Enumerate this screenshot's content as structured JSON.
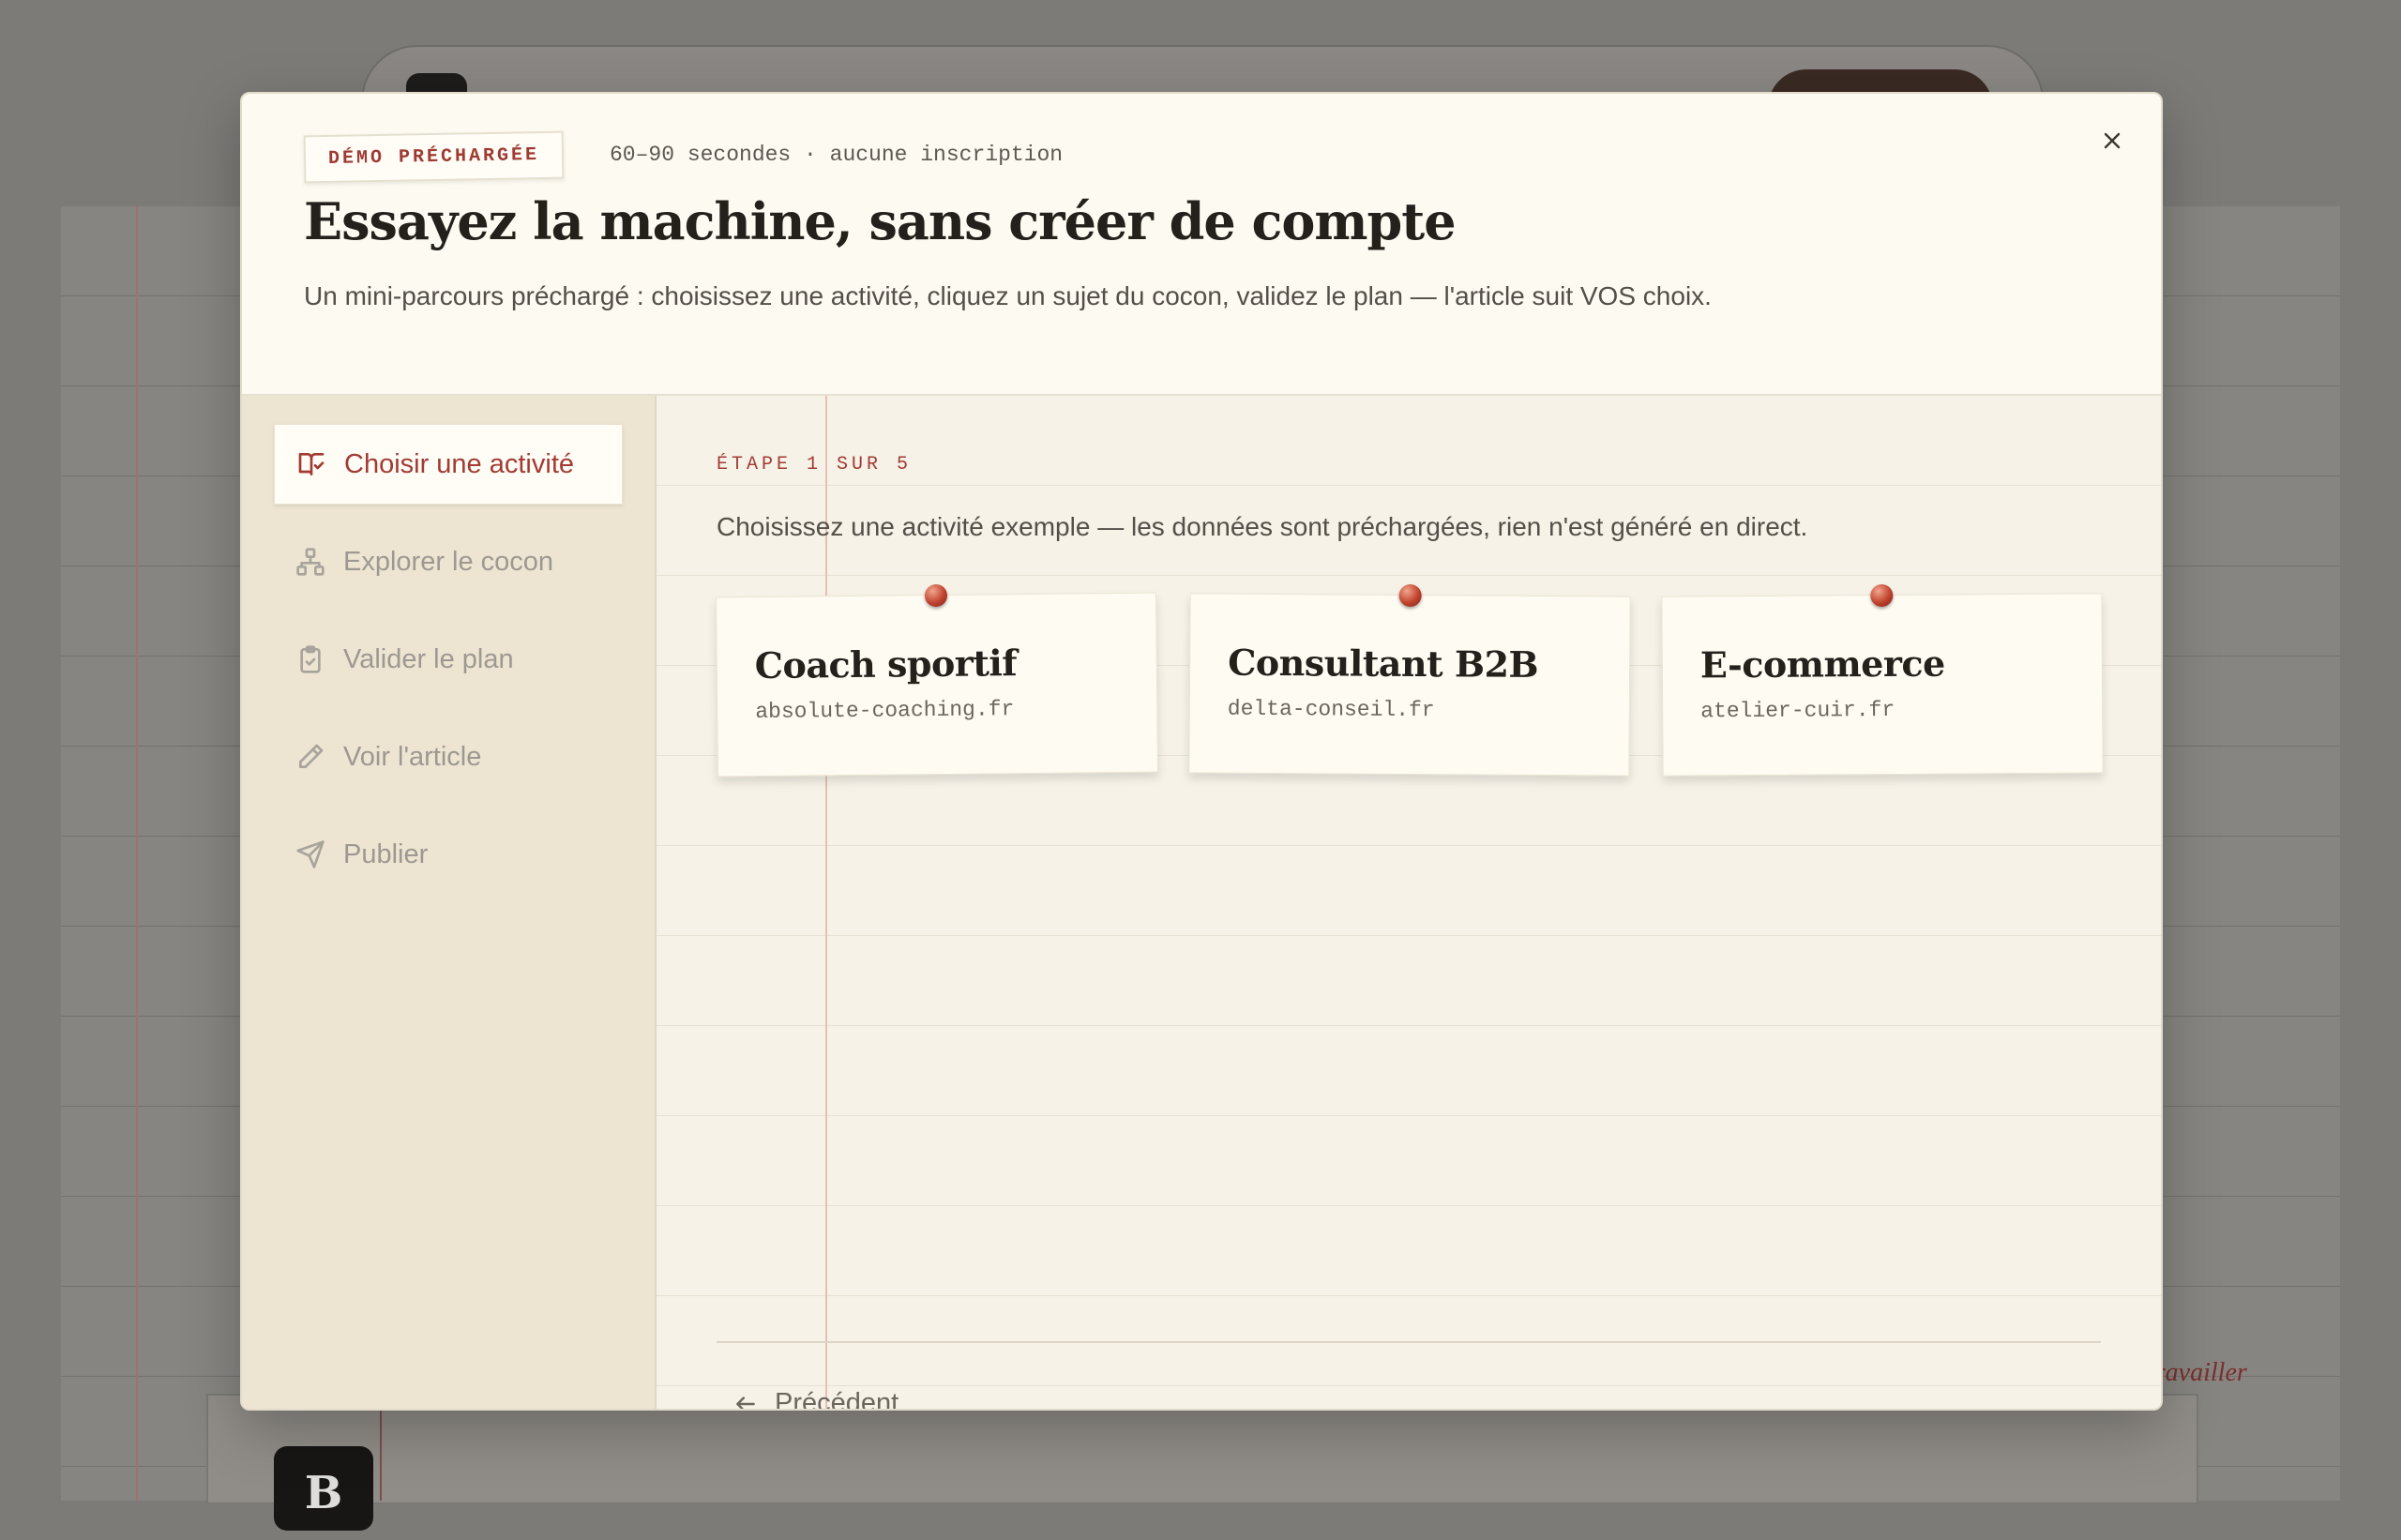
{
  "modal": {
    "badge": "DÉMO PRÉCHARGÉE",
    "meta": "60–90 secondes · aucune inscription",
    "title": "Essayez la machine, sans créer de compte",
    "subtitle": "Un mini-parcours préchargé : choisissez une activité, cliquez un sujet du cocon, validez le plan — l'article suit VOS choix."
  },
  "steps": [
    {
      "label": "Choisir une activité",
      "icon": "book-check-icon",
      "active": true
    },
    {
      "label": "Explorer le cocon",
      "icon": "network-icon",
      "active": false
    },
    {
      "label": "Valider le plan",
      "icon": "clipboard-check-icon",
      "active": false
    },
    {
      "label": "Voir l'article",
      "icon": "pencil-icon",
      "active": false
    },
    {
      "label": "Publier",
      "icon": "send-icon",
      "active": false
    }
  ],
  "main": {
    "step_label": "ÉTAPE 1 SUR 5",
    "intro": "Choisissez une activité exemple — les données sont préchargées, rien n'est généré en direct.",
    "cards": [
      {
        "title": "Coach sportif",
        "domain": "absolute-coaching.fr"
      },
      {
        "title": "Consultant B2B",
        "domain": "delta-conseil.fr"
      },
      {
        "title": "E-commerce",
        "domain": "atelier-cuir.fr"
      }
    ],
    "prev_label": "Précédent"
  },
  "background": {
    "note": "travailler",
    "card_logo": "B"
  },
  "colors": {
    "accent": "#a23b33",
    "panel": "#fdfaf1",
    "sidebar": "#ede4d2"
  }
}
